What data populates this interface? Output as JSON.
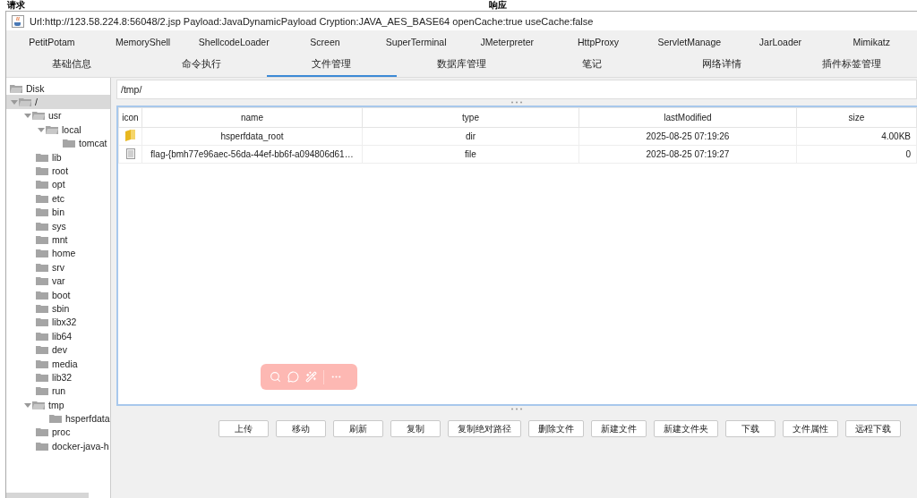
{
  "background": {
    "left_heading": "请求",
    "right_heading": "响应"
  },
  "window": {
    "title": "Url:http://123.58.224.8:56048/2.jsp Payload:JavaDynamicPayload Cryption:JAVA_AES_BASE64 openCache:true useCache:false"
  },
  "plugin_tabs": [
    {
      "label": "PetitPotam",
      "selected": false
    },
    {
      "label": "MemoryShell",
      "selected": false
    },
    {
      "label": "ShellcodeLoader",
      "selected": false
    },
    {
      "label": "Screen",
      "selected": false
    },
    {
      "label": "SuperTerminal",
      "selected": false
    },
    {
      "label": "JMeterpreter",
      "selected": false
    },
    {
      "label": "HttpProxy",
      "selected": false
    },
    {
      "label": "ServletManage",
      "selected": false
    },
    {
      "label": "JarLoader",
      "selected": false
    },
    {
      "label": "Mimikatz",
      "selected": false
    }
  ],
  "tabs": [
    {
      "label": "基础信息",
      "selected": false
    },
    {
      "label": "命令执行",
      "selected": false
    },
    {
      "label": "文件管理",
      "selected": true
    },
    {
      "label": "数据库管理",
      "selected": false
    },
    {
      "label": "笔记",
      "selected": false
    },
    {
      "label": "网络详情",
      "selected": false
    },
    {
      "label": "插件标签管理",
      "selected": false
    }
  ],
  "tree": [
    {
      "label": "Disk",
      "kind": "disk",
      "selected": false
    },
    {
      "label": "/",
      "selected": true,
      "expanded": true,
      "children": [
        {
          "label": "usr",
          "selected": false,
          "expanded": true,
          "children": [
            {
              "label": "local",
              "selected": false,
              "expanded": true,
              "children": [
                {
                  "label": "tomcat",
                  "selected": false
                }
              ]
            }
          ]
        },
        {
          "label": "lib",
          "selected": false
        },
        {
          "label": "root",
          "selected": false
        },
        {
          "label": "opt",
          "selected": false
        },
        {
          "label": "etc",
          "selected": false
        },
        {
          "label": "bin",
          "selected": false
        },
        {
          "label": "sys",
          "selected": false
        },
        {
          "label": "mnt",
          "selected": false
        },
        {
          "label": "home",
          "selected": false
        },
        {
          "label": "srv",
          "selected": false
        },
        {
          "label": "var",
          "selected": false
        },
        {
          "label": "boot",
          "selected": false
        },
        {
          "label": "sbin",
          "selected": false
        },
        {
          "label": "libx32",
          "selected": false
        },
        {
          "label": "lib64",
          "selected": false
        },
        {
          "label": "dev",
          "selected": false
        },
        {
          "label": "media",
          "selected": false
        },
        {
          "label": "lib32",
          "selected": false
        },
        {
          "label": "run",
          "selected": false
        },
        {
          "label": "tmp",
          "selected": false,
          "expanded": true,
          "children": [
            {
              "label": "hsperfdata",
              "selected": false
            }
          ]
        },
        {
          "label": "proc",
          "selected": false
        },
        {
          "label": "docker-java-h",
          "selected": false
        }
      ]
    }
  ],
  "path": {
    "value": "/tmp/"
  },
  "table": {
    "columns": [
      "icon",
      "name",
      "type",
      "lastModified",
      "size"
    ],
    "rows": [
      {
        "kind": "dir",
        "name": "hsperfdata_root",
        "type": "dir",
        "lastModified": "2025-08-25 07:19:26",
        "size": "4.00KB"
      },
      {
        "kind": "file",
        "name": "flag-{bmh77e96aec-56da-44ef-bb6f-a094806d61…",
        "type": "file",
        "lastModified": "2025-08-25 07:19:27",
        "size": "0"
      }
    ]
  },
  "buttons": [
    "上传",
    "移动",
    "刷新",
    "复制",
    "复制绝对路径",
    "删除文件",
    "新建文件",
    "新建文件夹",
    "下载",
    "文件属性",
    "远程下载"
  ]
}
